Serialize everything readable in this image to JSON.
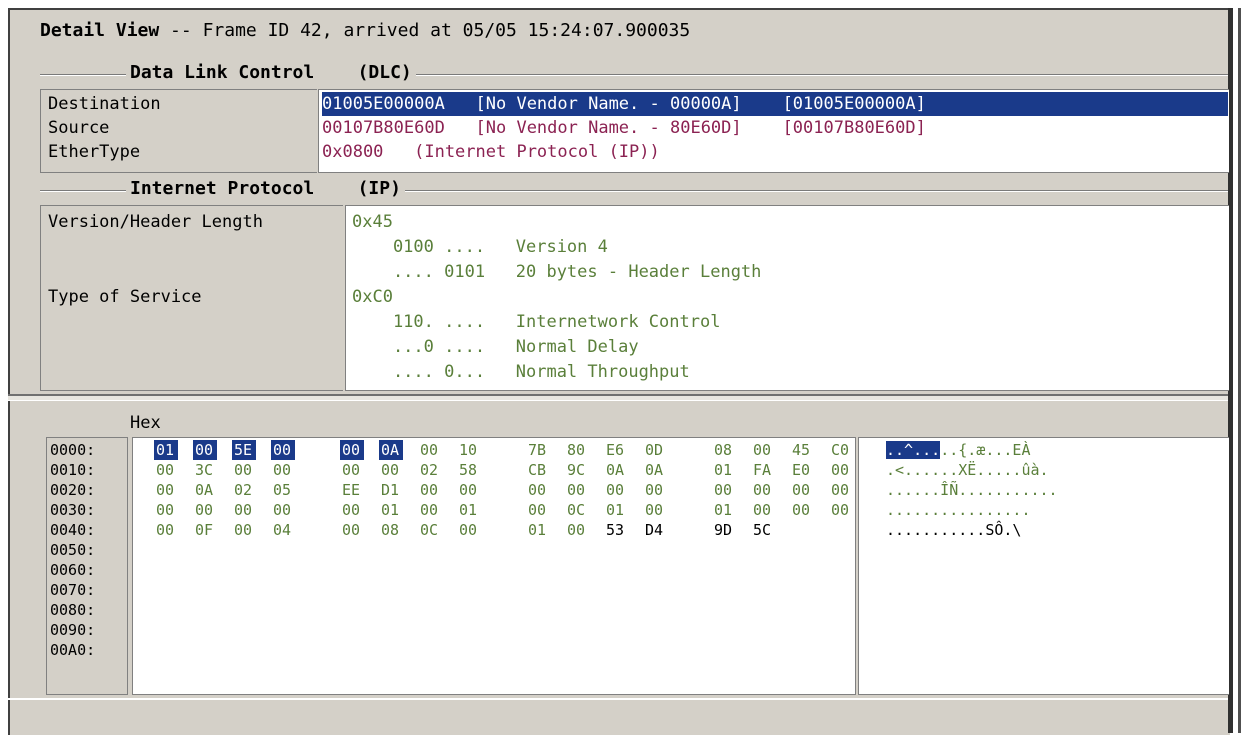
{
  "detail": {
    "title_bold": "Detail View",
    "title_rest": " -- Frame ID 42, arrived at 05/05 15:24:07.900035"
  },
  "dlc": {
    "section": "Data Link Control    (DLC)",
    "fields": [
      {
        "name": "Destination",
        "value": "01005E00000A   [No Vendor Name. - 00000A]    [01005E00000A]",
        "selected": true
      },
      {
        "name": "Source",
        "value": "00107B80E60D   [No Vendor Name. - 80E60D]    [00107B80E60D]",
        "selected": false
      },
      {
        "name": "EtherType",
        "value": "0x0800   (Internet Protocol (IP))",
        "selected": false
      }
    ]
  },
  "ip": {
    "section": "Internet Protocol    (IP)",
    "lines": [
      {
        "name": "Version/Header Length",
        "value": "0x45"
      },
      {
        "name": "",
        "value": "    0100 ....   Version 4"
      },
      {
        "name": "",
        "value": "    .... 0101   20 bytes - Header Length"
      },
      {
        "name": "Type of Service",
        "value": "0xC0"
      },
      {
        "name": "",
        "value": "    110. ....   Internetwork Control"
      },
      {
        "name": "",
        "value": "    ...0 ....   Normal Delay"
      },
      {
        "name": "",
        "value": "    .... 0...   Normal Throughput"
      }
    ]
  },
  "hex": {
    "label": "Hex",
    "offsets": [
      "0000:",
      "0010:",
      "0020:",
      "0030:",
      "0040:",
      "0050:",
      "0060:",
      "0070:",
      "0080:",
      "0090:",
      "00A0:"
    ],
    "rows": [
      [
        "01",
        "00",
        "5E",
        "00",
        "00",
        "0A",
        "00",
        "10",
        "7B",
        "80",
        "E6",
        "0D",
        "08",
        "00",
        "45",
        "C0"
      ],
      [
        "00",
        "3C",
        "00",
        "00",
        "00",
        "00",
        "02",
        "58",
        "CB",
        "9C",
        "0A",
        "0A",
        "01",
        "FA",
        "E0",
        "00"
      ],
      [
        "00",
        "0A",
        "02",
        "05",
        "EE",
        "D1",
        "00",
        "00",
        "00",
        "00",
        "00",
        "00",
        "00",
        "00",
        "00",
        "00"
      ],
      [
        "00",
        "00",
        "00",
        "00",
        "00",
        "01",
        "00",
        "01",
        "00",
        "0C",
        "01",
        "00",
        "01",
        "00",
        "00",
        "00"
      ],
      [
        "00",
        "0F",
        "00",
        "04",
        "00",
        "08",
        "0C",
        "00",
        "01",
        "00",
        "53",
        "D4",
        "9D",
        "5C"
      ]
    ],
    "ascii": [
      {
        "sel": "..^...",
        "rest": "..{.æ...EÀ"
      },
      {
        "sel": "",
        "rest": ".<......XË.....ûà."
      },
      {
        "sel": "",
        "rest": "......ÎÑ..........."
      },
      {
        "sel": "",
        "rest": "................"
      },
      {
        "sel": "",
        "rest": "...........SÔ.\\"
      }
    ]
  },
  "colors": {
    "selection": "#1a3a8a",
    "value_text": "#8b2252",
    "decode_text": "#5a7f3a",
    "window_bg": "#d4d0c8"
  }
}
